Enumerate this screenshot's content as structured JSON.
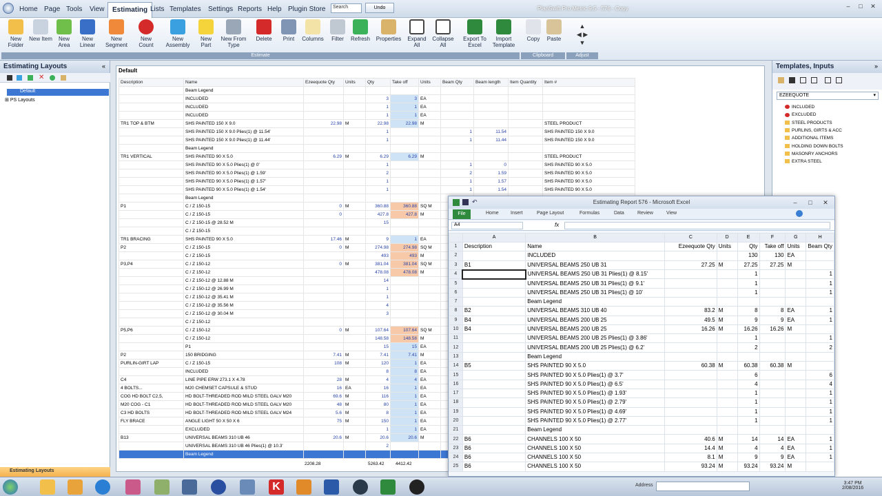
{
  "menu": {
    "items": [
      "Home",
      "Page",
      "Tools",
      "View",
      "Estimating",
      "Lists",
      "Templates",
      "Settings",
      "Reports",
      "Help",
      "Plugin Store"
    ],
    "search_placeholder": "Search",
    "undo": "Undo"
  },
  "app_title": "PlanSwift Pro Metric 9.5 - 576 - Copy",
  "ribbon": {
    "buttons": [
      "New Folder",
      "New Item",
      "New Area",
      "New Linear",
      "New Segment",
      "New Count",
      "New Assembly",
      "New Part",
      "New From Type",
      "Delete",
      "Print",
      "Columns",
      "Filter",
      "Refresh",
      "Properties",
      "Expand All",
      "Collapse All",
      "Export To Excel",
      "Import Template",
      "Copy",
      "Paste"
    ],
    "groups": [
      "Estimate",
      "Clipboard",
      "Adjust"
    ]
  },
  "left_pane": {
    "title": "Estimating Layouts",
    "items": [
      "Default",
      "PS Layouts"
    ],
    "footer": "Estimating Layouts"
  },
  "main": {
    "title": "Default",
    "columns": [
      "Description",
      "Name",
      "Ezeequote Qty",
      "Units",
      "Qty",
      "Take off",
      "Units",
      "Beam Qty",
      "Beam length",
      "Item Quantity",
      "Item #"
    ],
    "rows": [
      [
        "",
        "Beam Legend",
        "",
        "",
        "",
        "",
        "",
        "",
        "",
        "",
        ""
      ],
      [
        "",
        "INCLUDED",
        "",
        "",
        "3",
        "3",
        "EA",
        "",
        "",
        "",
        ""
      ],
      [
        "",
        "INCLUDED",
        "",
        "",
        "1",
        "1",
        "EA",
        "",
        "",
        "",
        ""
      ],
      [
        "",
        "INCLUDED",
        "",
        "",
        "1",
        "1",
        "EA",
        "",
        "",
        "",
        ""
      ],
      [
        "TR1 TOP & BTM",
        "SHS PAINTED 150 X 9.0",
        "22.98",
        "M",
        "22.98",
        "22.98",
        "M",
        "",
        "",
        "",
        "STEEL PRODUCT"
      ],
      [
        "",
        "SHS PAINTED 150 X 9.0 Plies(1) @ 11.54'",
        "",
        "",
        "1",
        "",
        "",
        "1",
        "11.54",
        "",
        "SHS PAINTED 150 X 9.0"
      ],
      [
        "",
        "SHS PAINTED 150 X 9.0 Plies(1) @ 11.44'",
        "",
        "",
        "1",
        "",
        "",
        "1",
        "11.44",
        "",
        "SHS PAINTED 150 X 9.0"
      ],
      [
        "",
        "Beam Legend",
        "",
        "",
        "",
        "",
        "",
        "",
        "",
        "",
        ""
      ],
      [
        "TR1 VERTICAL",
        "SHS PAINTED 90 X 5.0",
        "6.29",
        "M",
        "6.29",
        "6.29",
        "M",
        "",
        "",
        "",
        "STEEL PRODUCT"
      ],
      [
        "",
        "SHS PAINTED 90 X 5.0 Plies(1) @ 0'",
        "",
        "",
        "1",
        "",
        "",
        "1",
        "0",
        "",
        "SHS PAINTED 90 X 5.0"
      ],
      [
        "",
        "SHS PAINTED 90 X 5.0 Plies(1) @ 1.59'",
        "",
        "",
        "2",
        "",
        "",
        "2",
        "1.59",
        "",
        "SHS PAINTED 90 X 5.0"
      ],
      [
        "",
        "SHS PAINTED 90 X 5.0 Plies(1) @ 1.57'",
        "",
        "",
        "1",
        "",
        "",
        "1",
        "1.57",
        "",
        "SHS PAINTED 90 X 5.0"
      ],
      [
        "",
        "SHS PAINTED 90 X 5.0 Plies(1) @ 1.54'",
        "",
        "",
        "1",
        "",
        "",
        "1",
        "1.54",
        "",
        "SHS PAINTED 90 X 5.0"
      ],
      [
        "",
        "Beam Legend",
        "",
        "",
        "",
        "",
        "",
        "",
        "",
        "",
        ""
      ],
      [
        "P1",
        "C / Z 150-15",
        "0",
        "M",
        "360.88",
        "360.88",
        "SQ M",
        "",
        "",
        "",
        ""
      ],
      [
        "",
        "C / Z 150-15",
        "0",
        "",
        "427.8",
        "427.8",
        "M",
        "",
        "",
        "",
        ""
      ],
      [
        "",
        "C / Z 150-15 @ 28.52 M",
        "",
        "",
        "15",
        "",
        "",
        "",
        "",
        "",
        ""
      ],
      [
        "",
        "C / Z 150-15",
        "",
        "",
        "",
        "",
        "",
        "",
        "",
        "",
        ""
      ],
      [
        "TR1 BRACING",
        "SHS PAINTED 90 X 5.0",
        "17.46",
        "M",
        "9",
        "1",
        "EA",
        "",
        "",
        "",
        ""
      ],
      [
        "P2",
        "C / Z 150-15",
        "0",
        "M",
        "274.98",
        "274.98",
        "SQ M",
        "",
        "",
        "",
        ""
      ],
      [
        "",
        "C / Z 150-15",
        "",
        "",
        "493",
        "493",
        "M",
        "",
        "",
        "",
        ""
      ],
      [
        "P3,P4",
        "C / Z 150-12",
        "0",
        "M",
        "381.04",
        "381.04",
        "SQ M",
        "",
        "",
        "",
        ""
      ],
      [
        "",
        "C / Z 150-12",
        "",
        "",
        "478.08",
        "478.08",
        "M",
        "",
        "",
        "",
        ""
      ],
      [
        "",
        "C / Z 150-12 @ 12.88 M",
        "",
        "",
        "14",
        "",
        "",
        "",
        "",
        "",
        ""
      ],
      [
        "",
        "C / Z 150-12 @ 26.99 M",
        "",
        "",
        "1",
        "",
        "",
        "",
        "",
        "",
        ""
      ],
      [
        "",
        "C / Z 150-12 @ 35.41 M",
        "",
        "",
        "1",
        "",
        "",
        "",
        "",
        "",
        ""
      ],
      [
        "",
        "C / Z 150-12 @ 35.56 M",
        "",
        "",
        "4",
        "",
        "",
        "",
        "",
        "",
        ""
      ],
      [
        "",
        "C / Z 150-12 @ 30.04 M",
        "",
        "",
        "3",
        "",
        "",
        "",
        "",
        "",
        ""
      ],
      [
        "",
        "C / Z 150-12",
        "",
        "",
        "",
        "",
        "",
        "",
        "",
        "",
        ""
      ],
      [
        "P5,P6",
        "C / Z 150-12",
        "0",
        "M",
        "107.64",
        "107.64",
        "SQ M",
        "",
        "",
        "",
        ""
      ],
      [
        "",
        "C / Z 150-12",
        "",
        "",
        "148.58",
        "148.58",
        "M",
        "",
        "",
        "",
        ""
      ],
      [
        "",
        "P1",
        "",
        "",
        "15",
        "15",
        "EA",
        "",
        "",
        "",
        ""
      ],
      [
        "P2",
        "150 BRIDGING",
        "7.41",
        "M",
        "7.41",
        "7.41",
        "M",
        "",
        "",
        "",
        ""
      ],
      [
        "PURLIN-GIRT LAP",
        "C / Z 150-15",
        "108",
        "M",
        "120",
        "1",
        "EA",
        "",
        "",
        "",
        ""
      ],
      [
        "",
        "INCLUDED",
        "",
        "",
        "8",
        "8",
        "EA",
        "",
        "",
        "",
        ""
      ],
      [
        "C4",
        "LINE PIPE ERW 273.1 X 4.78",
        "28",
        "M",
        "4",
        "4",
        "EA",
        "",
        "",
        "",
        ""
      ],
      [
        "4 BOLTS...",
        "M20 CHEMSET CAPSULE & STUD",
        "16",
        "EA",
        "16",
        "1",
        "EA",
        "",
        "",
        "",
        ""
      ],
      [
        "COG HD BOLT C2,5,",
        "HD BOLT-THREADED ROD MILD STEEL GALV M20",
        "69.6",
        "M",
        "116",
        "1",
        "EA",
        "",
        "",
        "",
        ""
      ],
      [
        "M20 COG - C1",
        "HD BOLT-THREADED ROD MILD STEEL GALV M20",
        "48",
        "M",
        "80",
        "1",
        "EA",
        "",
        "",
        "",
        ""
      ],
      [
        "C3 HD BOLTS",
        "HD BOLT-THREADED ROD MILD STEEL GALV M24",
        "5.6",
        "M",
        "8",
        "1",
        "EA",
        "",
        "",
        "",
        ""
      ],
      [
        "FLY BRACE",
        "ANGLE LIGHT 50 X 50 X 6",
        "75",
        "M",
        "150",
        "1",
        "EA",
        "",
        "",
        "",
        ""
      ],
      [
        "",
        "EXCLUDED",
        "",
        "",
        "1",
        "1",
        "EA",
        "",
        "",
        "",
        ""
      ],
      [
        "B13",
        "UNIVERSAL BEAMS 310 UB 46",
        "20.6",
        "M",
        "20.6",
        "20.6",
        "M",
        "",
        "",
        "",
        ""
      ],
      [
        "",
        "UNIVERSAL BEAMS 310 UB 46 Plies(1) @ 10.3'",
        "",
        "",
        "2",
        "",
        "",
        "",
        "",
        "",
        ""
      ],
      [
        "",
        "Beam Legend",
        "",
        "",
        "",
        "",
        "",
        "",
        "",
        "",
        ""
      ]
    ],
    "totals": [
      "2208.28",
      "5263.42",
      "4412.42"
    ]
  },
  "right_pane": {
    "title": "Templates, Inputs",
    "dropdown": "EZEEQUOTE",
    "items": [
      "INCLUDED",
      "EXCLUDED",
      "STEEL PRODUCTS",
      "PURLINS, GIRTS & ACC",
      "ADDITIONAL ITEMS",
      "HOLDING DOWN BOLTS",
      "MASONRY ANCHORS",
      "EXTRA STEEL"
    ]
  },
  "excel": {
    "title": "Estimating Report 576  -  Microsoft Excel",
    "tabs": [
      "File",
      "Home",
      "Insert",
      "Page Layout",
      "Formulas",
      "Data",
      "Review",
      "View"
    ],
    "namebox": "A4",
    "fx": "fx",
    "col_letters": [
      "",
      "A",
      "B",
      "C",
      "D",
      "E",
      "F",
      "G",
      "H"
    ],
    "rows": [
      [
        "1",
        "Description",
        "Name",
        "Ezeequote Qty",
        "Units",
        "Qty",
        "Take off",
        "Units",
        "Beam Qty"
      ],
      [
        "2",
        "",
        "INCLUDED",
        "",
        "",
        "130",
        "130",
        "EA",
        ""
      ],
      [
        "3",
        "B1",
        "UNIVERSAL BEAMS 250 UB 31",
        "27.25",
        "M",
        "27.25",
        "27.25",
        "M",
        ""
      ],
      [
        "4",
        "",
        "UNIVERSAL BEAMS 250 UB 31 Plies(1) @ 8.15'",
        "",
        "",
        "1",
        "",
        "",
        "1"
      ],
      [
        "5",
        "",
        "UNIVERSAL BEAMS 250 UB 31 Plies(1) @ 9.1'",
        "",
        "",
        "1",
        "",
        "",
        "1"
      ],
      [
        "6",
        "",
        "UNIVERSAL BEAMS 250 UB 31 Plies(1) @ 10'",
        "",
        "",
        "1",
        "",
        "",
        "1"
      ],
      [
        "7",
        "",
        "Beam Legend",
        "",
        "",
        "",
        "",
        "",
        ""
      ],
      [
        "8",
        "B2",
        "UNIVERSAL BEAMS 310 UB 40",
        "83.2",
        "M",
        "8",
        "8",
        "EA",
        "1"
      ],
      [
        "9",
        "B4",
        "UNIVERSAL BEAMS 200 UB 25",
        "49.5",
        "M",
        "9",
        "9",
        "EA",
        "1"
      ],
      [
        "10",
        "B4",
        "UNIVERSAL BEAMS 200 UB 25",
        "16.26",
        "M",
        "16.26",
        "16.26",
        "M",
        ""
      ],
      [
        "11",
        "",
        "UNIVERSAL BEAMS 200 UB 25 Plies(1) @ 3.86'",
        "",
        "",
        "1",
        "",
        "",
        "1"
      ],
      [
        "12",
        "",
        "UNIVERSAL BEAMS 200 UB 25 Plies(1) @ 6.2'",
        "",
        "",
        "2",
        "",
        "",
        "2"
      ],
      [
        "13",
        "",
        "Beam Legend",
        "",
        "",
        "",
        "",
        "",
        ""
      ],
      [
        "14",
        "B5",
        "SHS PAINTED 90 X 5.0",
        "60.38",
        "M",
        "60.38",
        "60.38",
        "M",
        ""
      ],
      [
        "15",
        "",
        "SHS PAINTED 90 X 5.0 Plies(1) @ 3.7'",
        "",
        "",
        "6",
        "",
        "",
        "6"
      ],
      [
        "16",
        "",
        "SHS PAINTED 90 X 5.0 Plies(1) @ 6.5'",
        "",
        "",
        "4",
        "",
        "",
        "4"
      ],
      [
        "17",
        "",
        "SHS PAINTED 90 X 5.0 Plies(1) @ 1.93'",
        "",
        "",
        "1",
        "",
        "",
        "1"
      ],
      [
        "18",
        "",
        "SHS PAINTED 90 X 5.0 Plies(1) @ 2.79'",
        "",
        "",
        "1",
        "",
        "",
        "1"
      ],
      [
        "19",
        "",
        "SHS PAINTED 90 X 5.0 Plies(1) @ 4.69'",
        "",
        "",
        "1",
        "",
        "",
        "1"
      ],
      [
        "20",
        "",
        "SHS PAINTED 90 X 5.0 Plies(1) @ 2.77'",
        "",
        "",
        "1",
        "",
        "",
        "1"
      ],
      [
        "21",
        "",
        "Beam Legend",
        "",
        "",
        "",
        "",
        "",
        ""
      ],
      [
        "22",
        "B6",
        "CHANNELS 100 X 50",
        "40.6",
        "M",
        "14",
        "14",
        "EA",
        "1"
      ],
      [
        "23",
        "B6",
        "CHANNELS 100 X 50",
        "14.4",
        "M",
        "4",
        "4",
        "EA",
        "1"
      ],
      [
        "24",
        "B6",
        "CHANNELS 100 X 50",
        "8.1",
        "M",
        "9",
        "9",
        "EA",
        "1"
      ],
      [
        "25",
        "B6",
        "CHANNELS 100 X 50",
        "93.24",
        "M",
        "93.24",
        "93.24",
        "M",
        ""
      ]
    ]
  },
  "taskbar": {
    "address_label": "Address",
    "time": "3:47 PM",
    "date": "2/08/2016"
  }
}
